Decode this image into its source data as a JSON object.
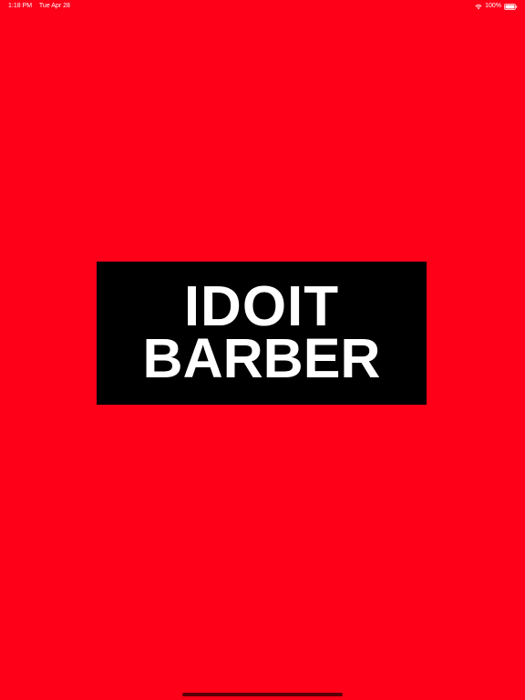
{
  "colors": {
    "background": "#ff0019",
    "logo_background": "#000000",
    "logo_text": "#ffffff",
    "status_text": "#ffffff",
    "home_indicator": "#5a0008"
  },
  "status_bar": {
    "time": "1:18 PM",
    "date": "Tue Apr 28",
    "battery": "100%",
    "icons": [
      "wifi-icon",
      "battery-icon"
    ]
  },
  "splash": {
    "logo_line_1": "IDOIT",
    "logo_line_2": "BARBER"
  }
}
